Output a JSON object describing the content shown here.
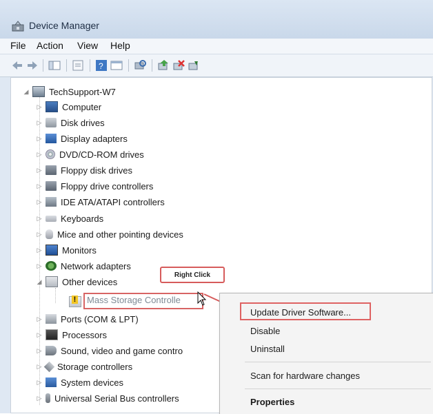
{
  "window": {
    "title": "Device Manager",
    "icon": "device-manager-icon"
  },
  "menu": {
    "items": [
      "File",
      "Action",
      "View",
      "Help"
    ]
  },
  "toolbar": {
    "buttons": [
      "back-icon",
      "forward-icon",
      "show-hide-tree-icon",
      "properties-icon",
      "help-icon",
      "view-icon",
      "scan-hardware-icon",
      "update-driver-icon",
      "uninstall-icon",
      "disable-icon"
    ]
  },
  "tree": {
    "root": "TechSupport-W7",
    "categories": [
      {
        "label": "Computer",
        "icon": "computer-icon"
      },
      {
        "label": "Disk drives",
        "icon": "disk-drive-icon"
      },
      {
        "label": "Display adapters",
        "icon": "display-adapter-icon"
      },
      {
        "label": "DVD/CD-ROM drives",
        "icon": "dvd-icon"
      },
      {
        "label": "Floppy disk drives",
        "icon": "floppy-disk-icon"
      },
      {
        "label": "Floppy drive controllers",
        "icon": "floppy-controller-icon"
      },
      {
        "label": "IDE ATA/ATAPI controllers",
        "icon": "ide-controller-icon"
      },
      {
        "label": "Keyboards",
        "icon": "keyboard-icon"
      },
      {
        "label": "Mice and other pointing devices",
        "icon": "mouse-icon"
      },
      {
        "label": "Monitors",
        "icon": "monitor-icon"
      },
      {
        "label": "Network adapters",
        "icon": "network-adapter-icon"
      },
      {
        "label": "Other devices",
        "icon": "other-devices-icon"
      },
      {
        "label": "Ports (COM & LPT)",
        "icon": "ports-icon"
      },
      {
        "label": "Processors",
        "icon": "processor-icon"
      },
      {
        "label": "Sound, video and game contro",
        "icon": "sound-icon"
      },
      {
        "label": "Storage controllers",
        "icon": "storage-controller-icon"
      },
      {
        "label": "System devices",
        "icon": "system-devices-icon"
      },
      {
        "label": "Universal Serial Bus controllers",
        "icon": "usb-icon"
      }
    ],
    "selected_device": "Mass Storage Controlle"
  },
  "annotation": {
    "callout": "Right Click"
  },
  "context_menu": {
    "update": "Update Driver Software...",
    "disable": "Disable",
    "uninstall": "Uninstall",
    "scan": "Scan for hardware changes",
    "properties": "Properties"
  },
  "colors": {
    "highlight_red": "#d65b5b",
    "disabled_text": "#7e8a95"
  }
}
